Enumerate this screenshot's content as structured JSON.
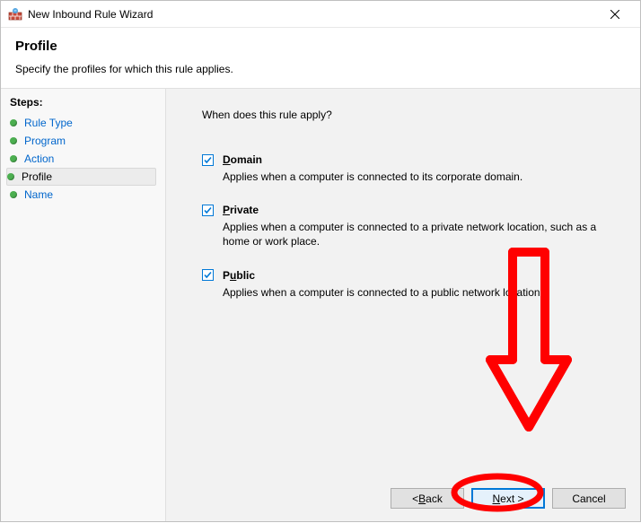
{
  "titlebar": {
    "title": "New Inbound Rule Wizard"
  },
  "header": {
    "title": "Profile",
    "subtitle": "Specify the profiles for which this rule applies."
  },
  "sidebar": {
    "title": "Steps:",
    "items": [
      {
        "label": "Rule Type",
        "current": false
      },
      {
        "label": "Program",
        "current": false
      },
      {
        "label": "Action",
        "current": false
      },
      {
        "label": "Profile",
        "current": true
      },
      {
        "label": "Name",
        "current": false
      }
    ]
  },
  "main": {
    "question": "When does this rule apply?",
    "options": [
      {
        "key": "domain",
        "underline": "D",
        "rest": "omain",
        "checked": true,
        "desc": "Applies when a computer is connected to its corporate domain."
      },
      {
        "key": "private",
        "underline": "P",
        "rest": "rivate",
        "checked": true,
        "desc": "Applies when a computer is connected to a private network location, such as a home or work place."
      },
      {
        "key": "public",
        "underline": "u",
        "pre": "P",
        "rest": "blic",
        "checked": true,
        "desc": "Applies when a computer is connected to a public network location."
      }
    ]
  },
  "buttons": {
    "back_pre": "< ",
    "back_u": "B",
    "back_rest": "ack",
    "next_u": "N",
    "next_rest": "ext >",
    "cancel": "Cancel"
  },
  "annotation": {
    "color": "#ff0000"
  }
}
